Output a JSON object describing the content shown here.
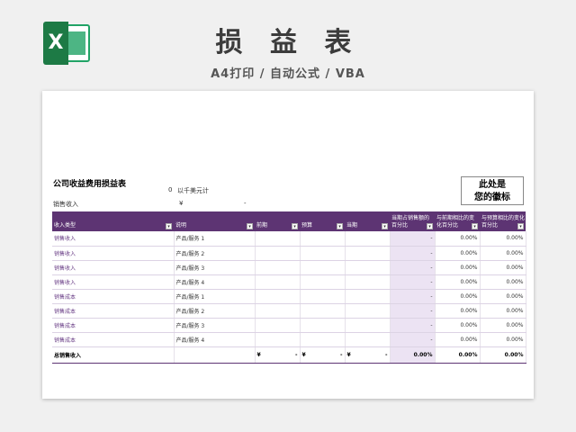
{
  "app": {
    "logo_letter": "X",
    "title": "损 益 表",
    "subtitle": "A4打印 / 自动公式 / VBA"
  },
  "sheet": {
    "report_title": "公司收益费用损益表",
    "unit_zero": "0",
    "unit_label": "以千美元计",
    "revenue_label": "销售收入",
    "revenue_currency": "¥",
    "revenue_value": "-",
    "logo_placeholder_line1": "此处是",
    "logo_placeholder_line2": "您的徽标"
  },
  "table": {
    "headers": [
      "收入类型",
      "说明",
      "前期",
      "预算",
      "当期",
      "当期占销售额的百分比",
      "与前期相比的变化百分比",
      "与预算相比的变化百分比"
    ],
    "rows": [
      {
        "type": "销售收入",
        "desc": "产品/服务 1",
        "c1": "-",
        "c2": "0.00%",
        "c3": "0.00%"
      },
      {
        "type": "销售收入",
        "desc": "产品/服务 2",
        "c1": "-",
        "c2": "0.00%",
        "c3": "0.00%"
      },
      {
        "type": "销售收入",
        "desc": "产品/服务 3",
        "c1": "-",
        "c2": "0.00%",
        "c3": "0.00%"
      },
      {
        "type": "销售收入",
        "desc": "产品/服务 4",
        "c1": "-",
        "c2": "0.00%",
        "c3": "0.00%"
      },
      {
        "type": "销售成本",
        "desc": "产品/服务 1",
        "c1": "-",
        "c2": "0.00%",
        "c3": "0.00%"
      },
      {
        "type": "销售成本",
        "desc": "产品/服务 2",
        "c1": "-",
        "c2": "0.00%",
        "c3": "0.00%"
      },
      {
        "type": "销售成本",
        "desc": "产品/服务 3",
        "c1": "-",
        "c2": "0.00%",
        "c3": "0.00%"
      },
      {
        "type": "销售成本",
        "desc": "产品/服务 4",
        "c1": "-",
        "c2": "0.00%",
        "c3": "0.00%"
      }
    ],
    "total": {
      "label": "总销售收入",
      "currency": "¥",
      "dash": "-",
      "pct1": "0.00%",
      "pct2": "0.00%",
      "pct3": "0.00%"
    }
  },
  "colors": {
    "header_bg": "#5d3473",
    "pct_bg": "#ece3f3",
    "excel_green": "#1d7a45"
  },
  "icons": {
    "logo": "excel-icon",
    "dropdown": "filter-dropdown-icon"
  }
}
